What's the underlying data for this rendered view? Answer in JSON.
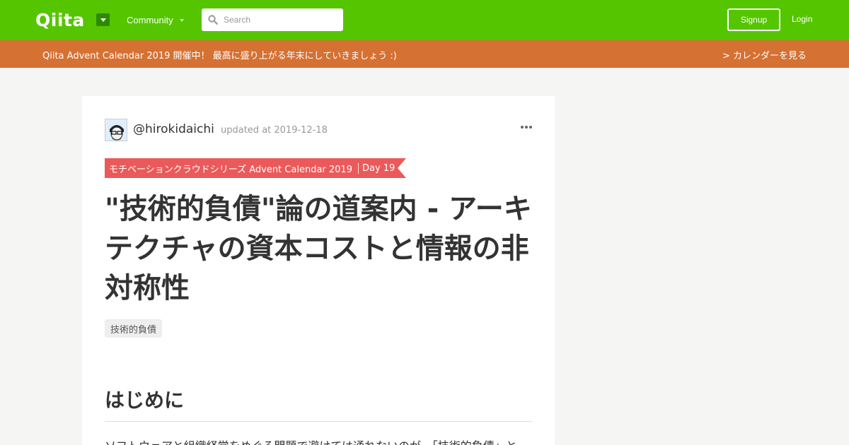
{
  "header": {
    "logo": "Qiita",
    "community_label": "Community",
    "search_placeholder": "Search",
    "signup_label": "Signup",
    "login_label": "Login",
    "brand_color": "#55c500"
  },
  "banner": {
    "message": "Qiita Advent Calendar 2019 開催中！ 最高に盛り上がる年末にしていきましょう :)",
    "calendar_link": "> カレンダーを見る",
    "color": "#d47133"
  },
  "article": {
    "author": "@hirokidaichi",
    "updated": "updated at 2019-12-18",
    "calendar_name": "モチベーションクラウドシリーズ Advent Calendar 2019",
    "calendar_day": "Day 19",
    "title": "\"技術的負債\"論の道案内 - アーキテクチャの資本コストと情報の非対称性",
    "tags": [
      "技術的負債"
    ],
    "section_heading": "はじめに",
    "first_paragraph": "ソフトウェアと組織経営をめぐる問題で避けては通れないのが、「技術的負債」と"
  }
}
